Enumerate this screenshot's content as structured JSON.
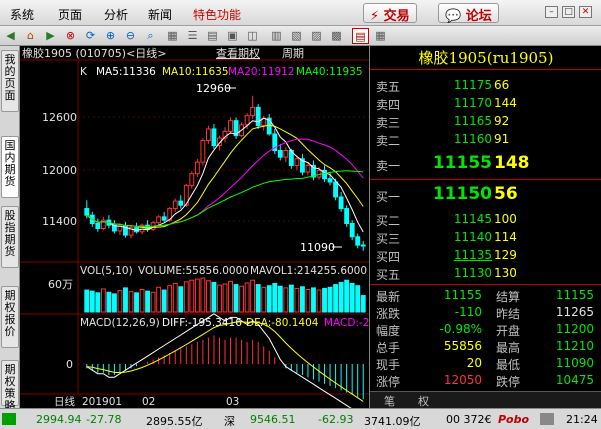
{
  "menu": {
    "items": [
      "系统",
      "页面",
      "分析",
      "新闻"
    ],
    "special": "特色功能",
    "trade": "交易",
    "forum": "论坛"
  },
  "toolbar": {
    "icons": [
      "back-icon",
      "home-icon",
      "forward-icon",
      "stop-icon",
      "refresh-icon",
      "zoom-in-icon",
      "zoom-out-icon",
      "search-icon",
      "grid-icon",
      "list-icon",
      "layout-icon",
      "f10-icon",
      "f1-icon",
      "chart-icon",
      "calendar-icon",
      "quote-icon",
      "window-icon",
      "notebook-icon",
      "ticker-icon"
    ]
  },
  "left_tabs": [
    {
      "label": "我的页面",
      "active": false
    },
    {
      "label": "国内期货",
      "active": true
    },
    {
      "label": "股指期货",
      "active": false
    },
    {
      "label": "期权报价",
      "active": false
    },
    {
      "label": "期权策略",
      "active": false
    }
  ],
  "chart_header": {
    "title": "橡胶1905 (010705)<日线>",
    "link": "查看期权",
    "period": "周期"
  },
  "ma_legend": {
    "k": "K",
    "ma5": "MA5:11336",
    "ma10": "MA10:11635",
    "ma20": "MA20:11912",
    "ma40": "MA40:11935"
  },
  "vol_legend": {
    "name": "VOL(5,10)",
    "volume": "VOLUME:55856.0000",
    "mavol1": "MAVOL1:214255.6000"
  },
  "macd_legend": {
    "name": "MACD(12,26,9)",
    "diff": "DIFF:-195.3416",
    "dea": "DEA:-80.1404",
    "macd": "MACD:-2"
  },
  "colors": {
    "up": "#ff3232",
    "down": "#00ffff",
    "ma5": "#ffffff",
    "ma10": "#ffff00",
    "ma20": "#ff00ff",
    "ma40": "#00ff00"
  },
  "chart_data": {
    "type": "candlestick",
    "price_axis": {
      "ticks": [
        "12600",
        "12000",
        "11400"
      ],
      "values": [
        12600,
        12000,
        11400
      ],
      "ylim": [
        10980,
        13150
      ]
    },
    "annotations": {
      "high": "12960",
      "low": "11090"
    },
    "volume_axis": {
      "ticks": [
        "60万"
      ]
    },
    "macd_axis": {
      "ticks": [
        "0"
      ]
    },
    "date_axis": {
      "labels": [
        "日线",
        "201901",
        "02",
        "03"
      ]
    },
    "candles": [
      [
        11600,
        11700,
        11480,
        11520
      ],
      [
        11520,
        11560,
        11380,
        11420
      ],
      [
        11420,
        11480,
        11320,
        11360
      ],
      [
        11360,
        11500,
        11340,
        11460
      ],
      [
        11460,
        11520,
        11360,
        11400
      ],
      [
        11400,
        11460,
        11300,
        11330
      ],
      [
        11330,
        11420,
        11280,
        11390
      ],
      [
        11390,
        11440,
        11250,
        11280
      ],
      [
        11280,
        11400,
        11240,
        11370
      ],
      [
        11370,
        11430,
        11300,
        11320
      ],
      [
        11320,
        11420,
        11290,
        11400
      ],
      [
        11400,
        11460,
        11320,
        11350
      ],
      [
        11350,
        11450,
        11330,
        11430
      ],
      [
        11430,
        11520,
        11380,
        11500
      ],
      [
        11500,
        11560,
        11440,
        11460
      ],
      [
        11460,
        11620,
        11440,
        11600
      ],
      [
        11600,
        11720,
        11560,
        11690
      ],
      [
        11690,
        11760,
        11600,
        11640
      ],
      [
        11640,
        11900,
        11620,
        11880
      ],
      [
        11880,
        12050,
        11840,
        12020
      ],
      [
        12020,
        12200,
        11980,
        12160
      ],
      [
        12160,
        12450,
        12120,
        12420
      ],
      [
        12420,
        12600,
        12380,
        12560
      ],
      [
        12560,
        12620,
        12320,
        12360
      ],
      [
        12360,
        12480,
        12300,
        12450
      ],
      [
        12450,
        12580,
        12400,
        12530
      ],
      [
        12530,
        12700,
        12500,
        12660
      ],
      [
        12660,
        12700,
        12440,
        12480
      ],
      [
        12480,
        12640,
        12460,
        12610
      ],
      [
        12610,
        12750,
        12560,
        12720
      ],
      [
        12720,
        12960,
        12680,
        12820
      ],
      [
        12820,
        12860,
        12560,
        12600
      ],
      [
        12600,
        12720,
        12540,
        12690
      ],
      [
        12690,
        12740,
        12480,
        12500
      ],
      [
        12500,
        12560,
        12260,
        12300
      ],
      [
        12300,
        12380,
        12180,
        12220
      ],
      [
        12220,
        12340,
        12160,
        12300
      ],
      [
        12300,
        12320,
        12080,
        12120
      ],
      [
        12120,
        12240,
        12060,
        12200
      ],
      [
        12200,
        12260,
        12000,
        12040
      ],
      [
        12040,
        12160,
        12000,
        12120
      ],
      [
        12120,
        12180,
        11940,
        11980
      ],
      [
        11980,
        12100,
        11950,
        12060
      ],
      [
        12060,
        12120,
        11920,
        11960
      ],
      [
        11960,
        12040,
        11880,
        11920
      ],
      [
        11920,
        11960,
        11700,
        11740
      ],
      [
        11740,
        11800,
        11560,
        11600
      ],
      [
        11600,
        11640,
        11380,
        11420
      ],
      [
        11420,
        11460,
        11220,
        11260
      ],
      [
        11260,
        11300,
        11120,
        11160
      ],
      [
        11160,
        11210,
        11090,
        11155
      ]
    ],
    "volumes": [
      40,
      38,
      35,
      42,
      36,
      33,
      39,
      44,
      37,
      35,
      41,
      38,
      36,
      45,
      40,
      48,
      52,
      46,
      55,
      58,
      60,
      62,
      57,
      54,
      49,
      51,
      56,
      50,
      47,
      53,
      58,
      50,
      45,
      48,
      52,
      47,
      44,
      49,
      43,
      46,
      41,
      44,
      40,
      43,
      45,
      50,
      54,
      58,
      52,
      48,
      30
    ],
    "macd_bars": [
      -2,
      -3,
      -4,
      -4,
      -5,
      -5,
      -4,
      -3,
      -2,
      -1,
      0,
      1,
      2,
      3,
      4,
      5,
      6,
      7,
      8,
      9,
      10,
      11,
      12,
      13,
      12,
      11,
      12,
      12,
      11,
      10,
      11,
      10,
      8,
      6,
      3,
      0,
      -2,
      -3,
      -4,
      -5,
      -6,
      -7,
      -8,
      -9,
      -10,
      -11,
      -12,
      -13,
      -14,
      -15,
      -16
    ]
  },
  "quote": {
    "title": "橡胶1905(ru1905)",
    "asks": [
      {
        "label": "卖五",
        "price": "11175",
        "vol": "66"
      },
      {
        "label": "卖四",
        "price": "11170",
        "vol": "144"
      },
      {
        "label": "卖三",
        "price": "11165",
        "vol": "92"
      },
      {
        "label": "卖二",
        "price": "11160",
        "vol": "91"
      }
    ],
    "ask1": {
      "label": "卖一",
      "price": "11155",
      "vol": "148"
    },
    "bid1": {
      "label": "买一",
      "price": "11150",
      "vol": "56"
    },
    "bids": [
      {
        "label": "买二",
        "price": "11145",
        "vol": "100"
      },
      {
        "label": "买三",
        "price": "11140",
        "vol": "114"
      },
      {
        "label": "买四",
        "price": "11135",
        "vol": "129"
      },
      {
        "label": "买五",
        "price": "11130",
        "vol": "130"
      }
    ],
    "stats": [
      {
        "l1": "最新",
        "v1": "11155",
        "c1": "green",
        "l2": "结算",
        "v2": "11155",
        "c2": "green"
      },
      {
        "l1": "涨跌",
        "v1": "-110",
        "c1": "green",
        "l2": "昨结",
        "v2": "11265",
        "c2": "white"
      },
      {
        "l1": "幅度",
        "v1": "-0.98%",
        "c1": "green",
        "l2": "开盘",
        "v2": "11200",
        "c2": "green"
      },
      {
        "l1": "总手",
        "v1": "55856",
        "c1": "yellow",
        "l2": "最高",
        "v2": "11210",
        "c2": "green"
      },
      {
        "l1": "现手",
        "v1": "20",
        "c1": "yellow",
        "l2": "最低",
        "v2": "11090",
        "c2": "green"
      },
      {
        "l1": "涨停",
        "v1": "12050",
        "c1": "red",
        "l2": "跌停",
        "v2": "10475",
        "c2": "green"
      }
    ],
    "tabs": [
      "笔",
      "权"
    ]
  },
  "status": {
    "idx1_value": "2994.94",
    "idx1_change": "-27.78",
    "idx1_amount": "2895.55亿",
    "idx2_name": "深",
    "idx2_value": "9546.51",
    "idx2_change": "-62.93",
    "idx2_amount": "3741.09亿",
    "other": "00 372€",
    "brand": "Pobo",
    "time": "21:24"
  }
}
